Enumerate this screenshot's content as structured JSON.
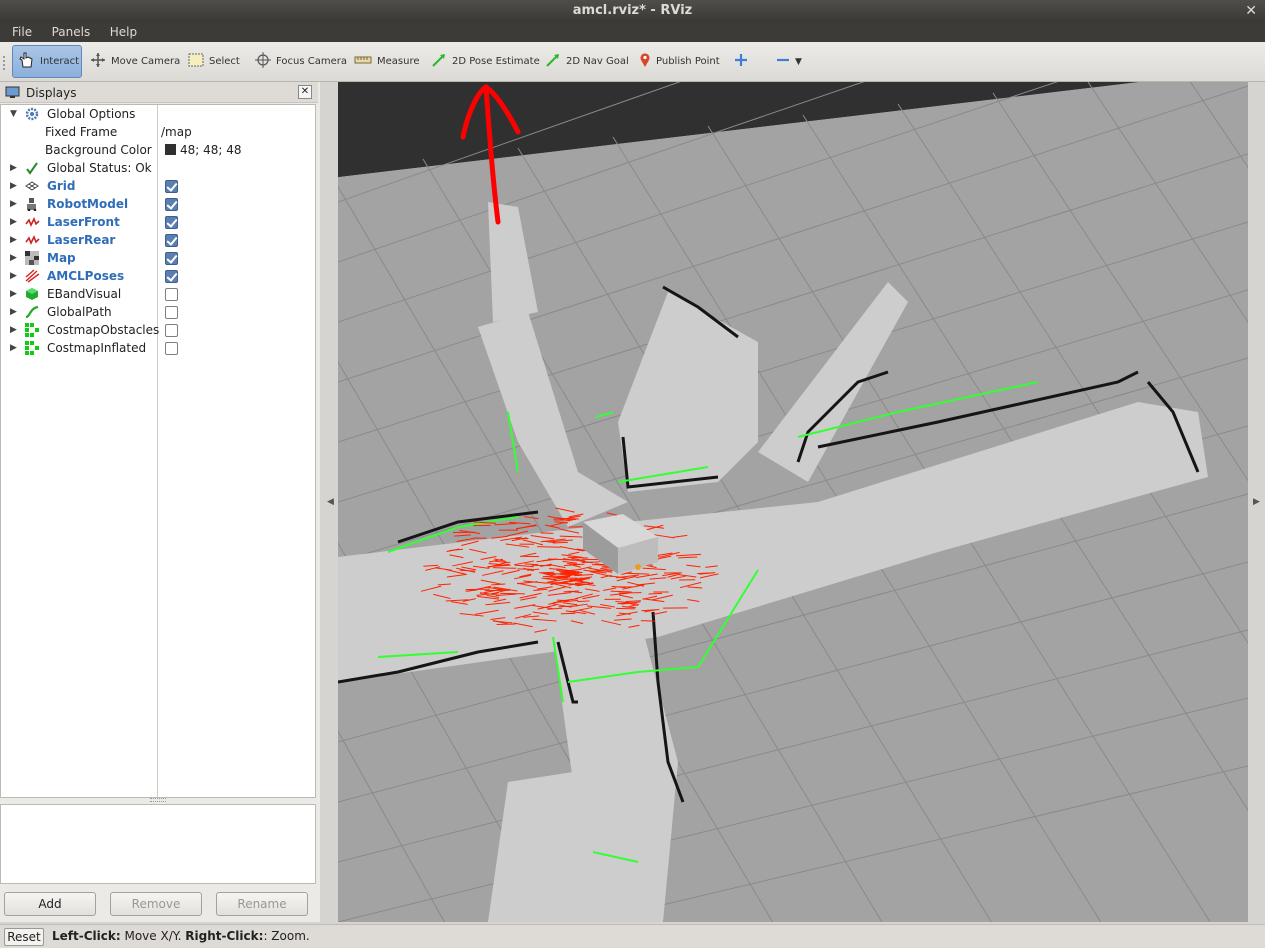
{
  "window": {
    "title": "amcl.rviz* - RViz"
  },
  "menu": {
    "file": "File",
    "panels": "Panels",
    "help": "Help"
  },
  "toolbar": {
    "interact": "Interact",
    "move_camera": "Move Camera",
    "select": "Select",
    "focus_camera": "Focus Camera",
    "measure": "Measure",
    "pose_estimate": "2D Pose Estimate",
    "nav_goal": "2D Nav Goal",
    "publish_point": "Publish Point"
  },
  "displays_panel": {
    "title": "Displays",
    "global_options": "Global Options",
    "fixed_frame_label": "Fixed Frame",
    "fixed_frame_value": "/map",
    "bg_color_label": "Background Color",
    "bg_color_value": "48; 48; 48",
    "global_status": "Global Status: Ok",
    "items": [
      {
        "label": "Grid",
        "checked": true,
        "icon": "grid-icon",
        "enabled": true
      },
      {
        "label": "RobotModel",
        "checked": true,
        "icon": "robot-icon",
        "enabled": true
      },
      {
        "label": "LaserFront",
        "checked": true,
        "icon": "laser-icon",
        "enabled": true
      },
      {
        "label": "LaserRear",
        "checked": true,
        "icon": "laser-icon",
        "enabled": true
      },
      {
        "label": "Map",
        "checked": true,
        "icon": "map-icon",
        "enabled": true
      },
      {
        "label": "AMCLPoses",
        "checked": true,
        "icon": "pose-array-icon",
        "enabled": true
      },
      {
        "label": "EBandVisual",
        "checked": false,
        "icon": "marker-icon",
        "enabled": false
      },
      {
        "label": "GlobalPath",
        "checked": false,
        "icon": "path-icon",
        "enabled": false
      },
      {
        "label": "CostmapObstacles",
        "checked": false,
        "icon": "grid-cells-icon",
        "enabled": false
      },
      {
        "label": "CostmapInflated",
        "checked": false,
        "icon": "grid-cells-icon",
        "enabled": false
      }
    ]
  },
  "buttons": {
    "add": "Add",
    "remove": "Remove",
    "rename": "Rename"
  },
  "statusbar": {
    "reset": "Reset",
    "left_click": "Left-Click:",
    "left_action": "Move X/Y.",
    "right_click": "Right-Click:",
    "right_action": ": Zoom."
  },
  "colors": {
    "background": "#303030",
    "map_free": "#c8c8c8",
    "grid": "#a0a0a0",
    "laser": "#33ff33",
    "poses": "#ff2200",
    "annotation": "#ff0000"
  }
}
